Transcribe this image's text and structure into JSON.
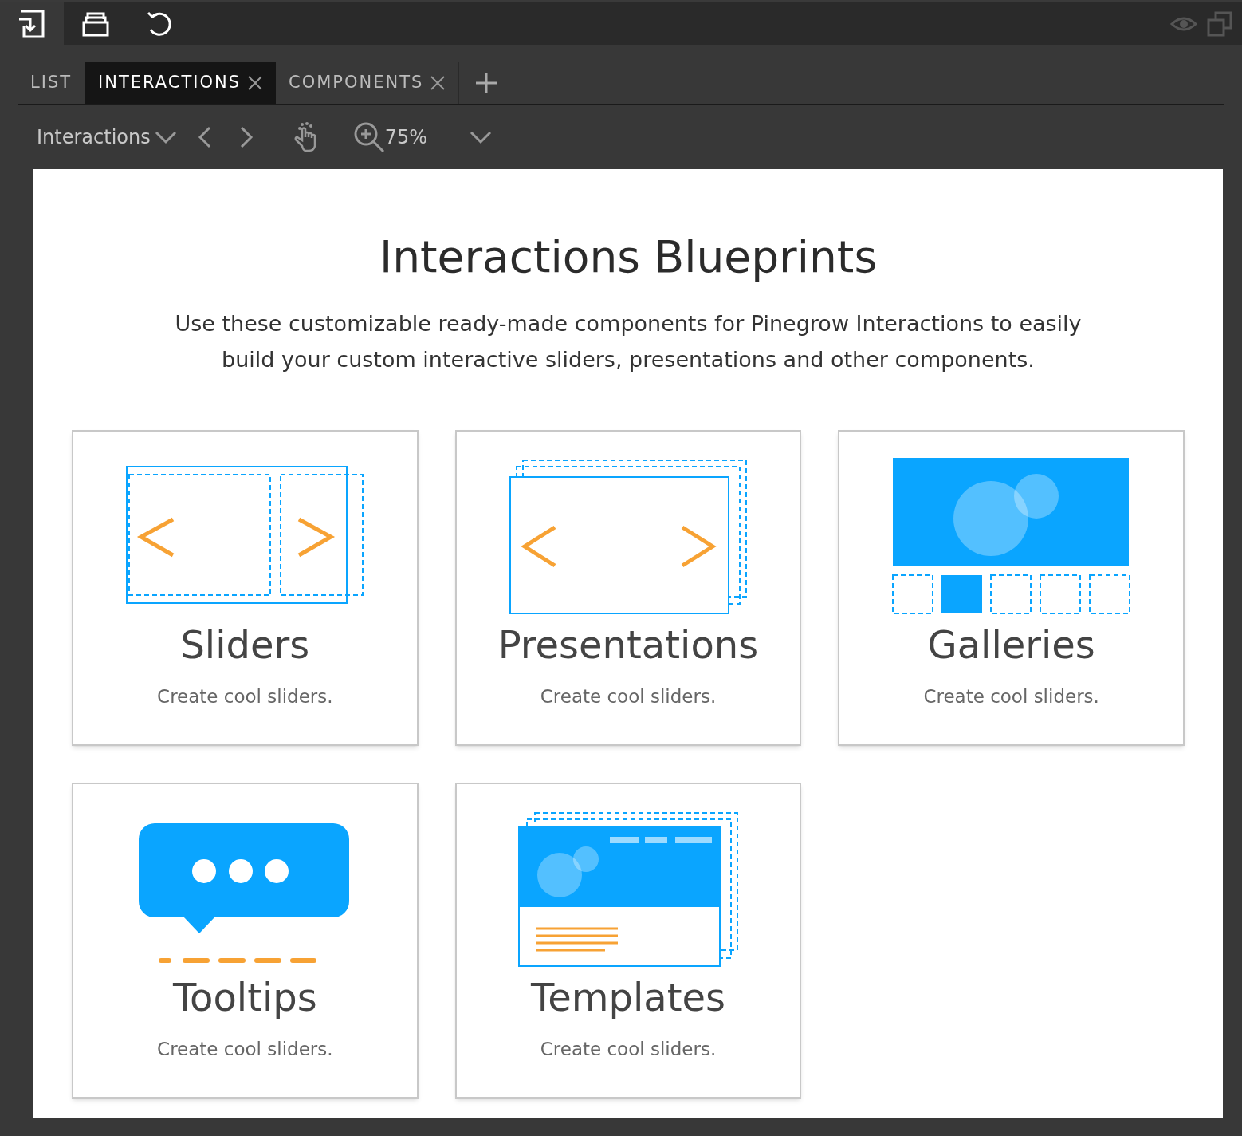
{
  "toolbar": {
    "buttons": [
      {
        "kind": "import",
        "selected": true
      },
      {
        "kind": "open",
        "selected": false
      },
      {
        "kind": "undo",
        "selected": false
      }
    ]
  },
  "tabs": [
    {
      "label": "LIST",
      "selected": false,
      "closable": false
    },
    {
      "label": "INTERACTIONS",
      "selected": true,
      "closable": true
    },
    {
      "label": "COMPONENTS",
      "selected": false,
      "closable": true
    }
  ],
  "subtoolbar": {
    "dropdown": "Interactions",
    "zoom": "75%"
  },
  "page": {
    "title": "Interactions Blueprints",
    "intro": "Use these customizable ready-made components for Pinegrow Interactions to easily build your custom interactive sliders, presentations and other components.",
    "cards": [
      {
        "kind": "sliders",
        "title": "Sliders",
        "description": "Create cool sliders."
      },
      {
        "kind": "presentations",
        "title": "Presentations",
        "description": "Create cool sliders."
      },
      {
        "kind": "galleries",
        "title": "Galleries",
        "description": "Create cool sliders."
      },
      {
        "kind": "tooltips",
        "title": "Tooltips",
        "description": "Create cool sliders."
      },
      {
        "kind": "templates",
        "title": "Templates",
        "description": "Create cool sliders."
      }
    ]
  }
}
